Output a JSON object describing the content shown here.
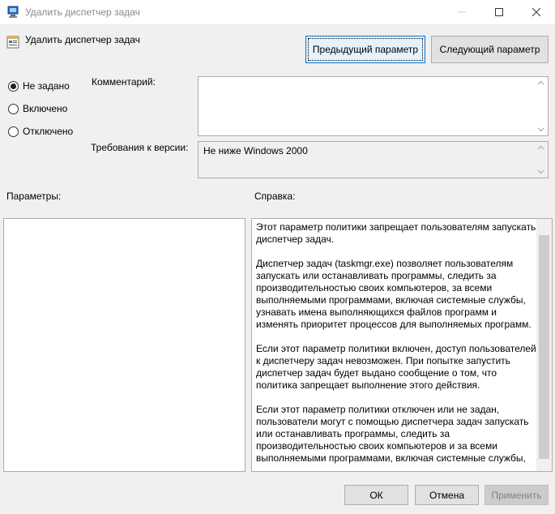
{
  "window": {
    "title": "Удалить диспетчер задач"
  },
  "header": {
    "policy_title": "Удалить диспетчер задач",
    "prev_button": "Предыдущий параметр",
    "next_button": "Следующий параметр"
  },
  "state": {
    "options": [
      {
        "label": "Не задано",
        "checked": true
      },
      {
        "label": "Включено",
        "checked": false
      },
      {
        "label": "Отключено",
        "checked": false
      }
    ]
  },
  "comment": {
    "label": "Комментарий:",
    "value": ""
  },
  "version": {
    "label": "Требования к версии:",
    "value": "Не ниже Windows 2000"
  },
  "params": {
    "label": "Параметры:"
  },
  "help": {
    "label": "Справка:",
    "paragraphs": [
      "Этот параметр политики запрещает пользователям запускать диспетчер задач.",
      "Диспетчер задач (taskmgr.exe) позволяет пользователям запускать или останавливать программы, следить за производительностью своих компьютеров, за всеми выполняемыми программами, включая системные службы, узнавать имена выполняющихся файлов программ и изменять приоритет процессов для выполняемых программ.",
      "Если этот параметр политики включен, доступ пользователей к диспетчеру задач невозможен. При попытке запустить диспетчер задач будет выдано сообщение о том, что политика запрещает выполнение этого действия.",
      "Если этот параметр политики отключен или не задан, пользователи могут с помощью диспетчера задач запускать или останавливать программы, следить за производительностью своих компьютеров и за всеми выполняемыми программами, включая системные службы,"
    ]
  },
  "footer": {
    "ok": "ОК",
    "cancel": "Отмена",
    "apply": "Применить"
  },
  "colors": {
    "focused_button_border": "#0078d7",
    "focused_button_bg": "#e5f1fb",
    "window_bg": "#f0f0f0"
  }
}
